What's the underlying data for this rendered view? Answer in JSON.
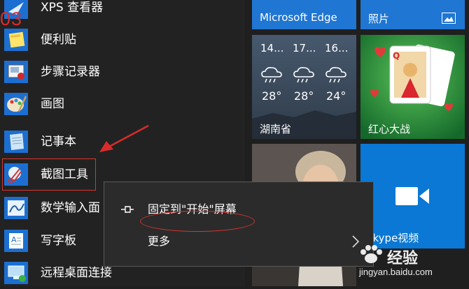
{
  "apps": [
    {
      "label": "XPS 查看器",
      "icon": "xps-viewer-icon"
    },
    {
      "label": "便利贴",
      "icon": "sticky-notes-icon"
    },
    {
      "label": "步骤记录器",
      "icon": "steps-recorder-icon"
    },
    {
      "label": "画图",
      "icon": "paint-icon"
    },
    {
      "label": "记事本",
      "icon": "notepad-icon"
    },
    {
      "label": "截图工具",
      "icon": "snipping-tool-icon"
    },
    {
      "label": "数学输入面",
      "icon": "math-input-icon"
    },
    {
      "label": "写字板",
      "icon": "wordpad-icon"
    },
    {
      "label": "远程桌面连接",
      "icon": "remote-desktop-icon"
    }
  ],
  "annotation_number": "03",
  "tiles": {
    "edge": "Microsoft Edge",
    "photos": "照片",
    "weather": {
      "days": [
        "14...",
        "17...",
        "16..."
      ],
      "temps": [
        "28°",
        "28°",
        "24°"
      ],
      "location": "湖南省"
    },
    "solitaire": "红心大战",
    "skype": "Skype视频"
  },
  "context_menu": {
    "pin_label": "固定到\"开始\"屏幕",
    "more_label": "更多"
  },
  "watermark": {
    "brand": "经验",
    "url": "jingyan.baidu.com"
  },
  "colors": {
    "accent": "#1f76d3",
    "annotation": "#d9352f",
    "list_bg": "#222222",
    "menu_bg": "#2b2b2b"
  }
}
